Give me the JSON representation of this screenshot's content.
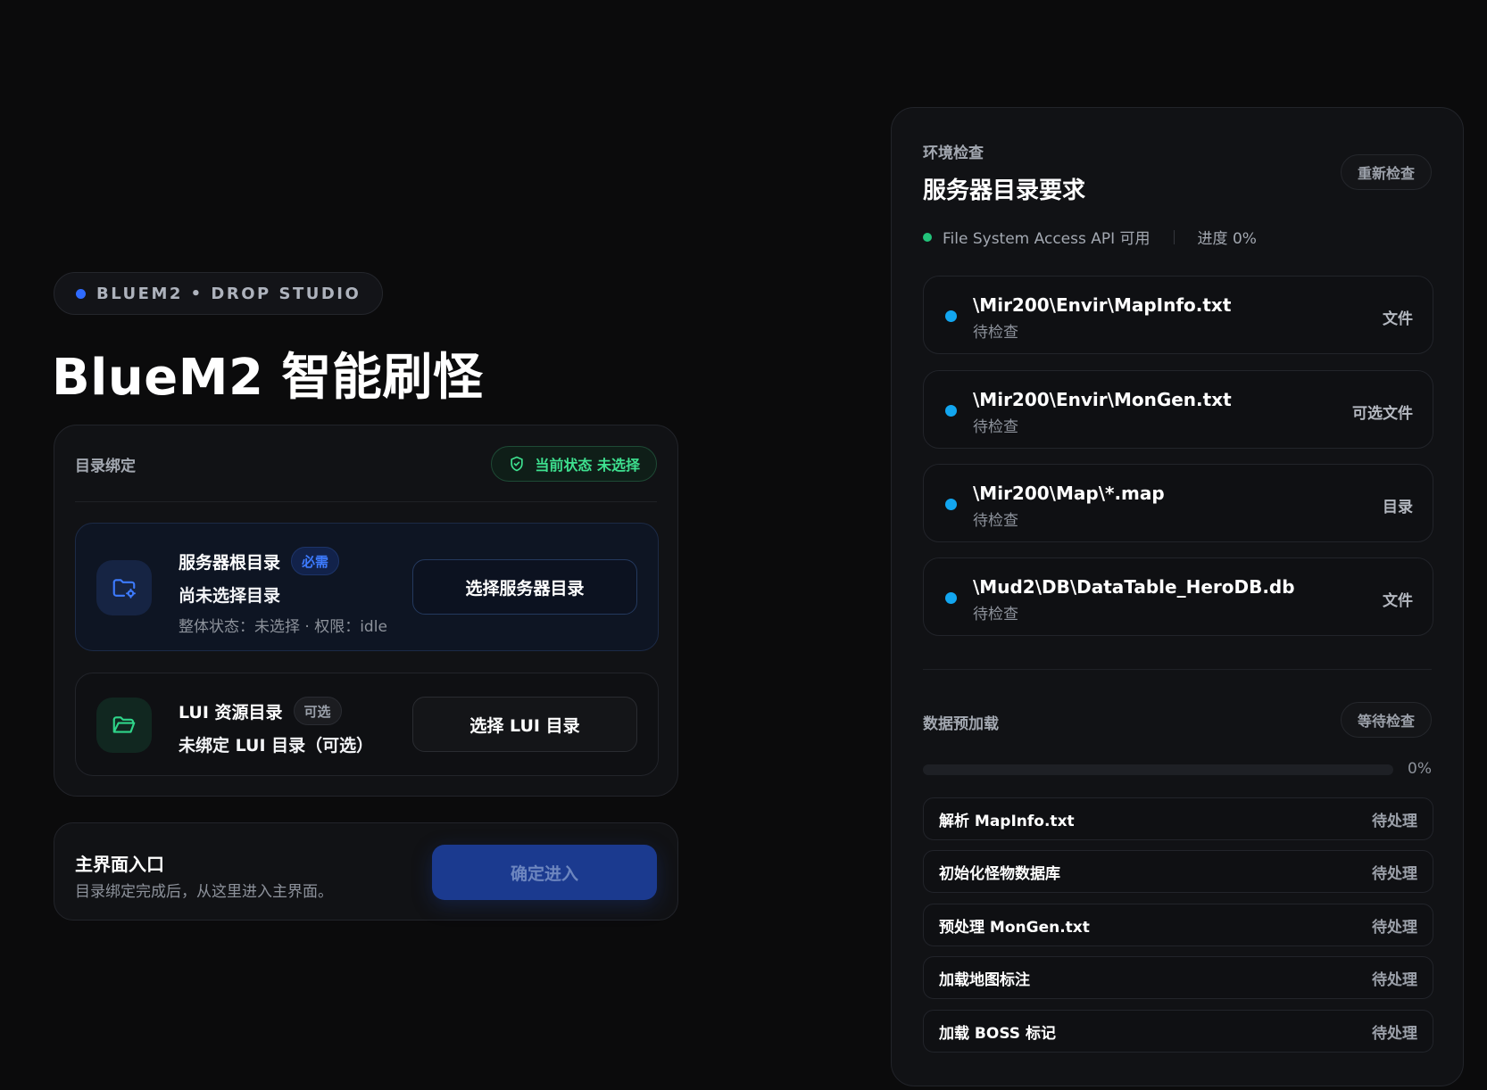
{
  "brand": {
    "label": "BLUEM2 • DROP STUDIO",
    "dot_color": "#2f6bff"
  },
  "hero": {
    "title": "BlueM2 智能刷怪"
  },
  "bind": {
    "label": "目录绑定",
    "status": "当前状态 未选择",
    "server": {
      "title": "服务器根目录",
      "tag": "必需",
      "subtitle": "尚未选择目录",
      "meta": "整体状态：未选择 · 权限：idle",
      "button": "选择服务器目录",
      "icon": "folder-settings-icon"
    },
    "lui": {
      "title": "LUI 资源目录",
      "tag": "可选",
      "subtitle": "未绑定 LUI 目录（可选）",
      "button": "选择 LUI 目录",
      "icon": "folder-open-icon"
    }
  },
  "enter": {
    "title": "主界面入口",
    "subtitle": "目录绑定完成后，从这里进入主界面。",
    "button": "确定进入"
  },
  "env": {
    "eyebrow": "环境检查",
    "title": "服务器目录要求",
    "recheck": "重新检查",
    "api_status": "File System Access API 可用",
    "progress_text": "进度 0%",
    "items": [
      {
        "path": "\\Mir200\\Envir\\MapInfo.txt",
        "status": "待检查",
        "type": "文件"
      },
      {
        "path": "\\Mir200\\Envir\\MonGen.txt",
        "status": "待检查",
        "type": "可选文件"
      },
      {
        "path": "\\Mir200\\Map\\*.map",
        "status": "待检查",
        "type": "目录"
      },
      {
        "path": "\\Mud2\\DB\\DataTable_HeroDB.db",
        "status": "待检查",
        "type": "文件"
      }
    ]
  },
  "preload": {
    "label": "数据预加载",
    "state": "等待检查",
    "progress": 0,
    "progress_label": "0%",
    "tasks": [
      {
        "name": "解析 MapInfo.txt",
        "state": "待处理"
      },
      {
        "name": "初始化怪物数据库",
        "state": "待处理"
      },
      {
        "name": "预处理 MonGen.txt",
        "state": "待处理"
      },
      {
        "name": "加载地图标注",
        "state": "待处理"
      },
      {
        "name": "加载 BOSS 标记",
        "state": "待处理"
      }
    ]
  },
  "colors": {
    "accent": "#2f6bff",
    "success": "#3ee08f",
    "item_dot": "#12a6f0"
  }
}
